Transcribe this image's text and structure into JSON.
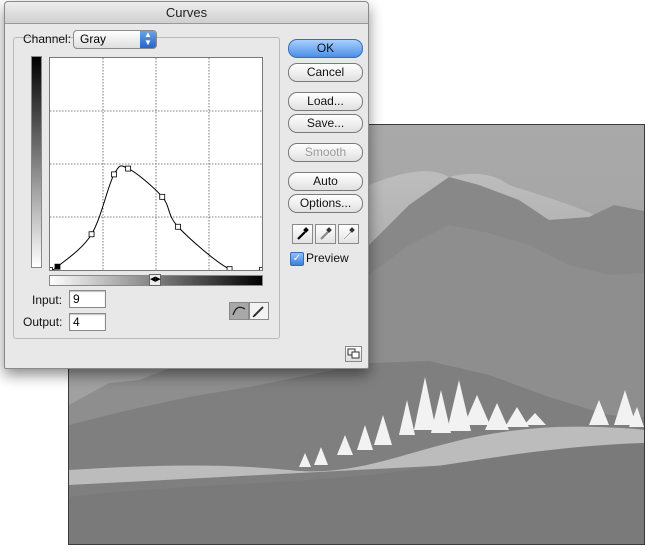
{
  "dialog": {
    "title": "Curves",
    "channel": {
      "label": "Channel:",
      "value": "Gray"
    },
    "input": {
      "label": "Input:",
      "value": "9"
    },
    "output": {
      "label": "Output:",
      "value": "4"
    },
    "buttons": {
      "ok": "OK",
      "cancel": "Cancel",
      "load": "Load...",
      "save": "Save...",
      "smooth": "Smooth",
      "auto": "Auto",
      "options": "Options..."
    },
    "preview": {
      "label": "Preview",
      "checked": true
    },
    "curve": {
      "points": [
        [
          0,
          0
        ],
        [
          9,
          4
        ],
        [
          50,
          43
        ],
        [
          77,
          115
        ],
        [
          94,
          122
        ],
        [
          135,
          88
        ],
        [
          154,
          52
        ],
        [
          216,
          1
        ],
        [
          255,
          0
        ]
      ],
      "selected_point": 1
    },
    "icons": {
      "eyedroppers": [
        "black-point-eyedropper-icon",
        "gray-point-eyedropper-icon",
        "white-point-eyedropper-icon"
      ],
      "modes": [
        "curve-mode-icon",
        "pencil-mode-icon"
      ],
      "expand": "expand-grid-icon"
    }
  },
  "colors": {
    "accent": "#4d8ee6",
    "dialog_bg": "#e8e8e8"
  }
}
